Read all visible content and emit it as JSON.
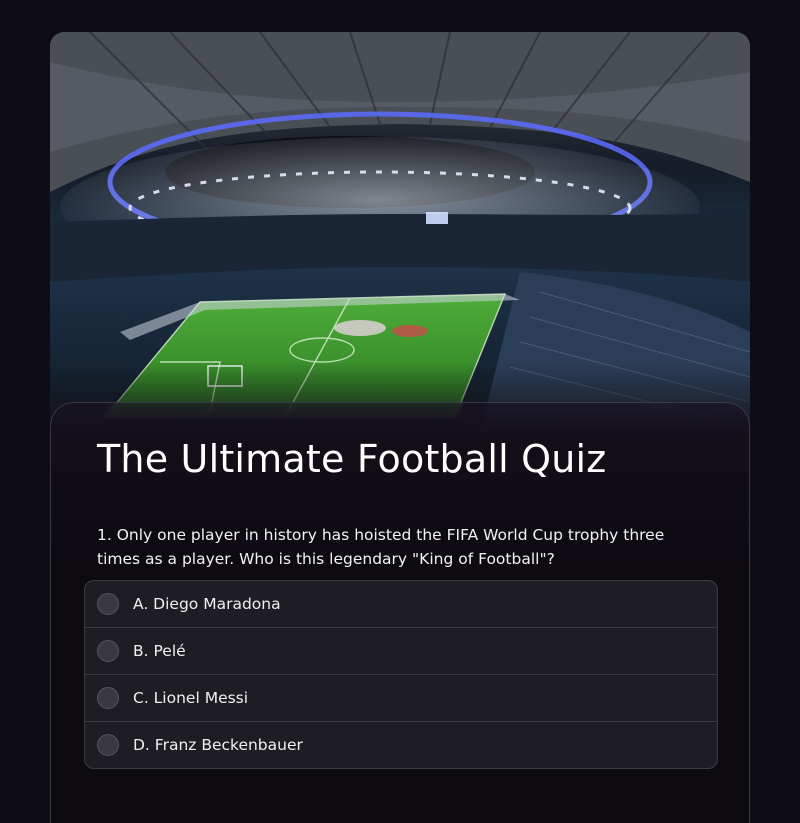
{
  "quiz": {
    "title": "The Ultimate Football Quiz",
    "question": "1. Only one player in history has hoisted the FIFA World Cup trophy three times as a player. Who is this legendary \"King of Football\"?",
    "options": [
      {
        "label": "A. Diego Maradona"
      },
      {
        "label": "B. Pelé"
      },
      {
        "label": "C. Lionel Messi"
      },
      {
        "label": "D. Franz Beckenbauer"
      }
    ]
  },
  "hero": {
    "image_subject": "football stadium at night with floodlights"
  },
  "colors": {
    "background": "#0e0c14",
    "panel": "#0d0a10",
    "option_bg": "#1e1d23",
    "border": "#3b3b42",
    "pitch": "#3c9a2e",
    "stadium_lights": "#5a6cff"
  }
}
